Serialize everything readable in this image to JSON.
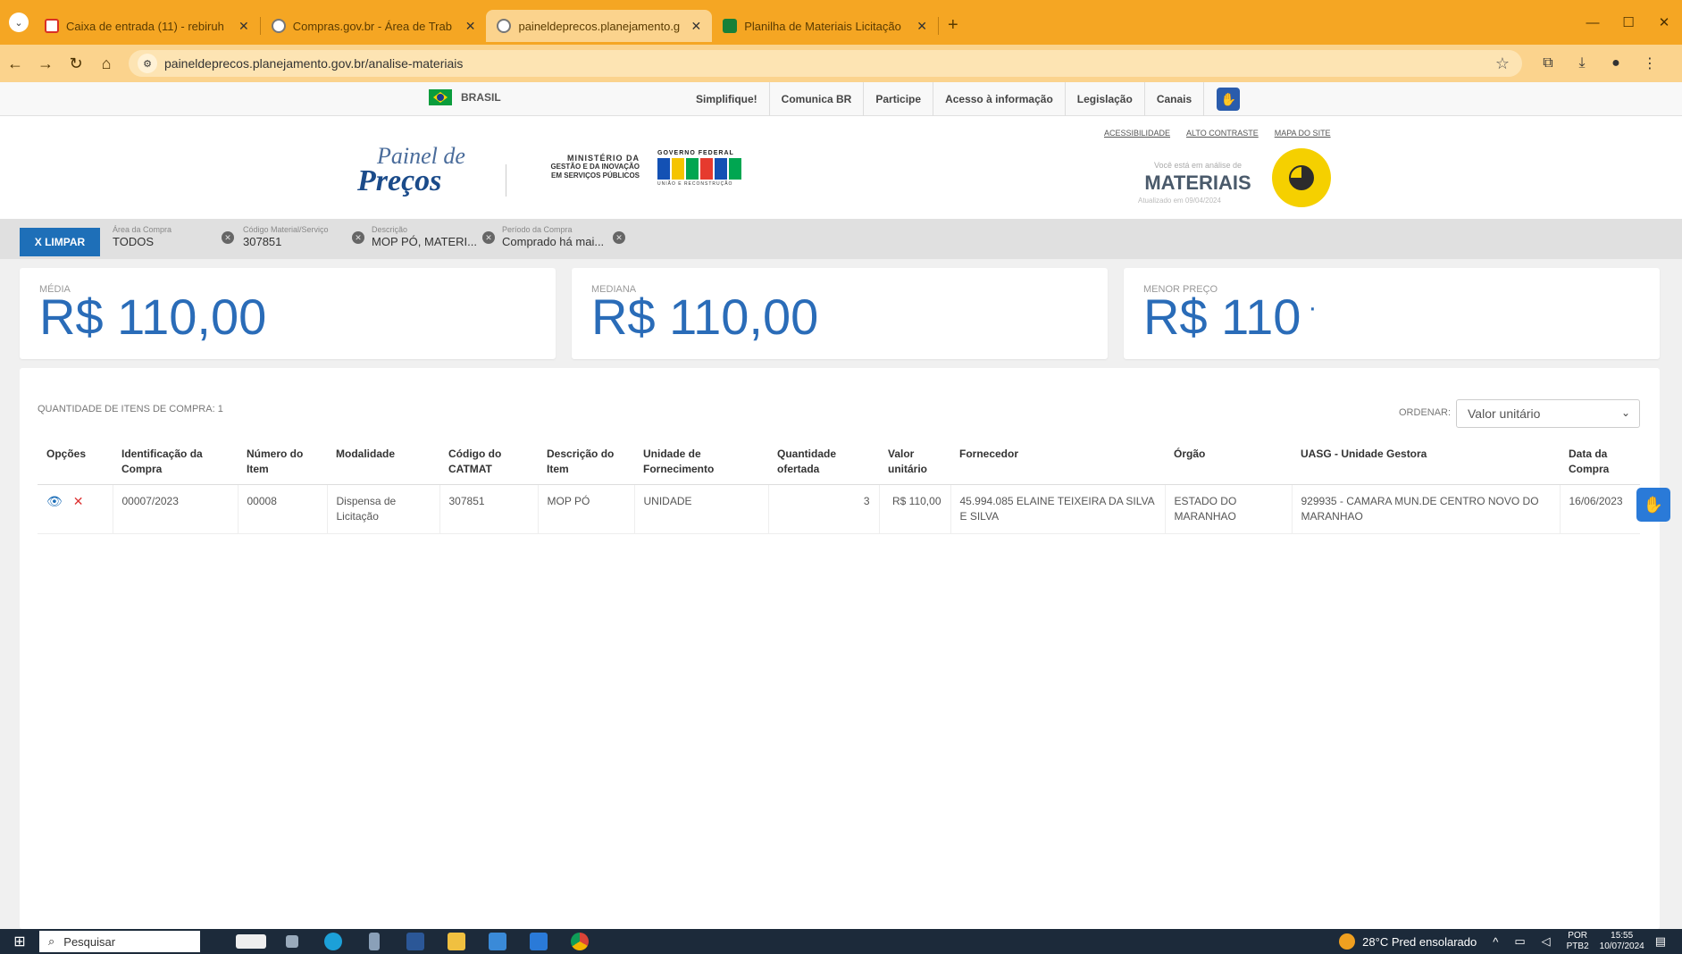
{
  "browser": {
    "tabs": [
      {
        "label": "Caixa de entrada (11) - rebiruh",
        "color": "#d93025",
        "icon": "gmail-icon"
      },
      {
        "label": "Compras.gov.br - Área de Trab",
        "color": "#555555",
        "icon": "globe-icon"
      },
      {
        "label": "paineldeprecos.planejamento.g",
        "color": "#555555",
        "icon": "globe-icon",
        "active": true
      },
      {
        "label": "Planilha de Materiais Licitação",
        "color": "#188038",
        "icon": "sheets-icon"
      }
    ],
    "close": "✕",
    "new_tab": "+",
    "url": "paineldeprecos.planejamento.gov.br/analise-materiais",
    "window": {
      "minimize": "—",
      "maximize": "☐",
      "close": "✕"
    }
  },
  "govbar": {
    "brasil": "BRASIL",
    "links": [
      "Simplifique!",
      "Comunica BR",
      "Participe",
      "Acesso à informação",
      "Legislação",
      "Canais"
    ]
  },
  "header": {
    "logo_top": "Painel de",
    "logo_bottom": "Preços",
    "ministerio_1": "MINISTÉRIO DA",
    "ministerio_2": "GESTÃO E DA INOVAÇÃO",
    "ministerio_3": "EM SERVIÇOS PÚBLICOS",
    "gov_1": "GOVERNO FEDERAL",
    "gov_3": "UNIÃO E RECONSTRUÇÃO",
    "top_links": [
      "ACESSIBILIDADE",
      "ALTO CONTRASTE",
      "MAPA DO SITE"
    ],
    "context_small": "Você está em análise de",
    "context_big": "MATERIAIS",
    "context_updated": "Atualizado em 09/04/2024"
  },
  "filters": {
    "limpar": "X  LIMPAR",
    "items": [
      {
        "label": "Área da Compra",
        "value": "TODOS"
      },
      {
        "label": "Código Material/Serviço",
        "value": "307851"
      },
      {
        "label": "Descrição",
        "value": "MOP PÓ, MATERI..."
      },
      {
        "label": "Período da Compra",
        "value": "Comprado há mai..."
      }
    ]
  },
  "stats": {
    "media_label": "MÉDIA",
    "media_value": "R$ 110,00",
    "mediana_label": "MEDIANA",
    "mediana_value": "R$ 110,00",
    "menor_label": "MENOR PREÇO",
    "menor_value": "R$ 110",
    "menor_tick": "·"
  },
  "table": {
    "quantidade": "QUANTIDADE DE ITENS DE COMPRA: 1",
    "ordenar_label": "ORDENAR:",
    "ordenar_value": "Valor unitário",
    "headers": [
      "Opções",
      "Identificação da Compra",
      "Número do Item",
      "Modalidade",
      "Código do CATMAT",
      "Descrição do Item",
      "Unidade de Fornecimento",
      "Quantidade ofertada",
      "Valor unitário",
      "Fornecedor",
      "Órgão",
      "UASG - Unidade Gestora",
      "Data da Compra"
    ],
    "rows": [
      {
        "id": "00007/2023",
        "item": "00008",
        "modalidade": "Dispensa de Licitação",
        "catmat": "307851",
        "descricao": "MOP PÓ",
        "unidade": "UNIDADE",
        "quantidade": "3",
        "valor": "R$ 110,00",
        "fornecedor": "45.994.085 ELAINE TEIXEIRA DA SILVA E SILVA",
        "orgao": "ESTADO DO MARANHAO",
        "uasg": "929935 - CAMARA MUN.DE CENTRO NOVO DO MARANHAO",
        "data": "16/06/2023"
      }
    ]
  },
  "taskbar": {
    "search": "Pesquisar",
    "weather": "28°C  Pred ensolarado",
    "lang_1": "POR",
    "lang_2": "PTB2",
    "time": "15:55",
    "date": "10/07/2024"
  },
  "colors": {
    "accent": "#1e6fb8",
    "browser": "#f5a623",
    "price": "#2a6cb8"
  }
}
